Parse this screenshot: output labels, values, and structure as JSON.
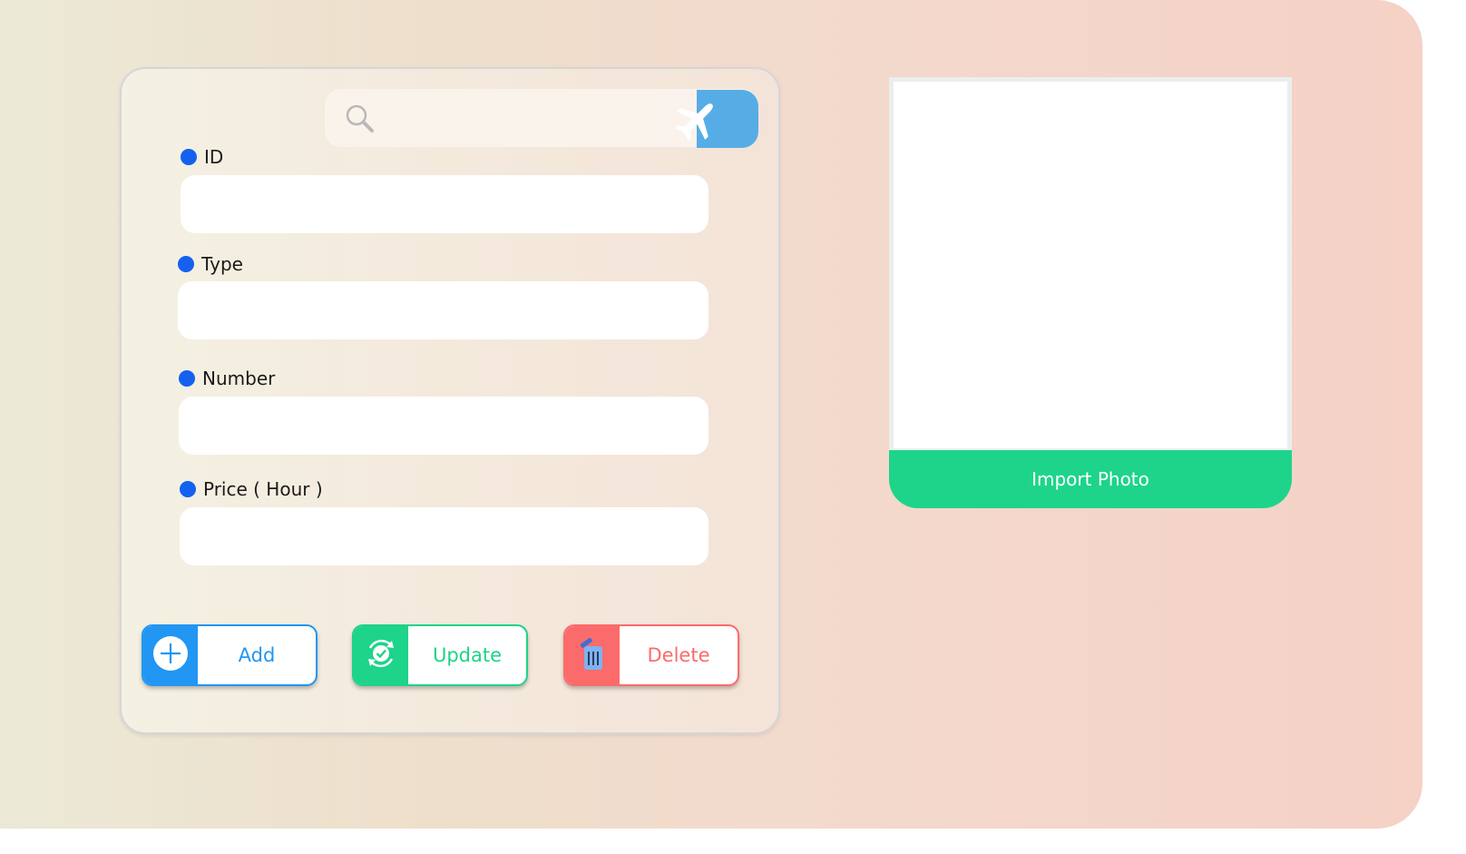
{
  "search": {
    "placeholder": "",
    "value": "",
    "icon": "magnifier-icon",
    "button_icon": "airplane-icon"
  },
  "form": {
    "fields": [
      {
        "label": "ID",
        "value": ""
      },
      {
        "label": "Type",
        "value": ""
      },
      {
        "label": "Number",
        "value": ""
      },
      {
        "label": "Price ( Hour )",
        "value": ""
      }
    ]
  },
  "actions": {
    "add": {
      "label": "Add",
      "icon": "plus-circle-icon",
      "color": "#2196f3"
    },
    "update": {
      "label": "Update",
      "icon": "refresh-check-icon",
      "color": "#1ed38a"
    },
    "delete": {
      "label": "Delete",
      "icon": "trash-icon",
      "color": "#fb6b6b"
    }
  },
  "photo": {
    "import_label": "Import Photo",
    "color": "#1ed48a"
  },
  "colors": {
    "accent_blue": "#1461f0",
    "search_button": "#56ade6"
  }
}
